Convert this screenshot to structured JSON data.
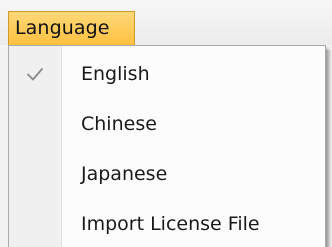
{
  "menu": {
    "title": "Language",
    "items": [
      {
        "label": "English",
        "checked": true,
        "icon": "check-icon"
      },
      {
        "label": "Chinese",
        "checked": false
      },
      {
        "label": "Japanese",
        "checked": false
      },
      {
        "label": "Import License File",
        "checked": false
      }
    ]
  },
  "colors": {
    "menu_title_bg": "#ffc03f",
    "menu_title_border": "#d29a2a",
    "dropdown_bg": "#fcfcfc",
    "gutter_bg": "#f0f0f0",
    "check_color": "#8a8a8a"
  }
}
